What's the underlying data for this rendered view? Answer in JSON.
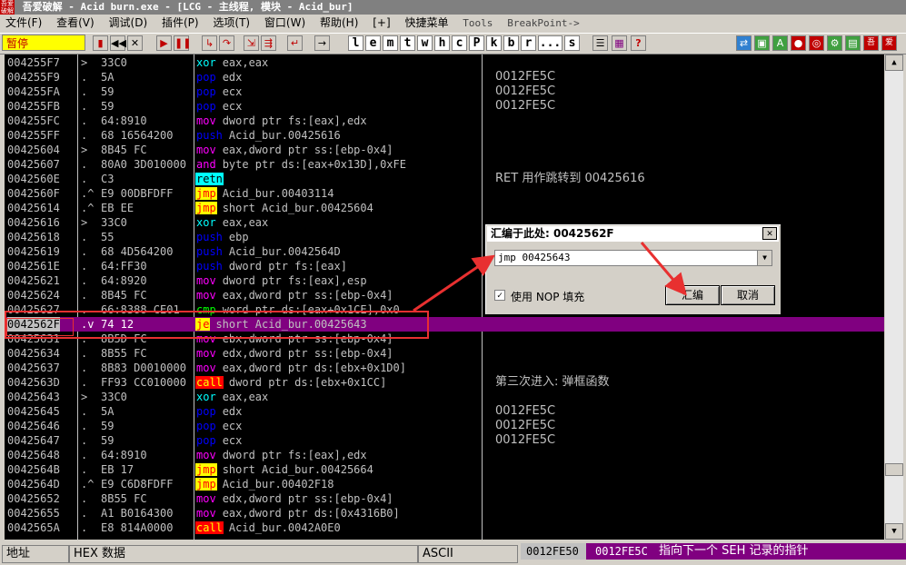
{
  "window": {
    "title": "吾爱破解 - Acid burn.exe - [LCG - 主线程, 模块 - Acid_bur]"
  },
  "menu": [
    "文件(F)",
    "查看(V)",
    "调试(D)",
    "插件(P)",
    "选项(T)",
    "窗口(W)",
    "帮助(H)",
    "[+]",
    "快捷菜单",
    "Tools",
    "BreakPoint->"
  ],
  "toolbar": {
    "status": "暂停",
    "letters": [
      "l",
      "e",
      "m",
      "t",
      "w",
      "h",
      "c",
      "P",
      "k",
      "b",
      "r",
      "...",
      "s"
    ]
  },
  "disasm": {
    "rows": [
      {
        "addr": "004255F7",
        "mark": ">",
        "hex": "33C0",
        "op": "xor",
        "args": "eax,eax",
        "cmt": ""
      },
      {
        "addr": "004255F9",
        "mark": ".",
        "hex": "5A",
        "op": "pop",
        "args": "edx",
        "cmt": "0012FE5C"
      },
      {
        "addr": "004255FA",
        "mark": ".",
        "hex": "59",
        "op": "pop",
        "args": "ecx",
        "cmt": "0012FE5C"
      },
      {
        "addr": "004255FB",
        "mark": ".",
        "hex": "59",
        "op": "pop",
        "args": "ecx",
        "cmt": "0012FE5C"
      },
      {
        "addr": "004255FC",
        "mark": ".",
        "hex": "64:8910",
        "op": "mov",
        "args": "dword ptr fs:[eax],edx",
        "cmt": ""
      },
      {
        "addr": "004255FF",
        "mark": ".",
        "hex": "68 16564200",
        "op": "push",
        "args": "Acid_bur.00425616",
        "cmt": ""
      },
      {
        "addr": "00425604",
        "mark": ">",
        "hex": "8B45 FC",
        "op": "mov",
        "args": "eax,dword ptr ss:[ebp-0x4]",
        "cmt": ""
      },
      {
        "addr": "00425607",
        "mark": ".",
        "hex": "80A0 3D010000",
        "op": "and",
        "args": "byte ptr ds:[eax+0x13D],0xFE",
        "cmt": ""
      },
      {
        "addr": "0042560E",
        "mark": ".",
        "hex": "C3",
        "op": "retn",
        "args": "",
        "cmt": "RET 用作跳转到 00425616"
      },
      {
        "addr": "0042560F",
        "mark": ".^",
        "hex": "E9 00DBFDFF",
        "op": "jmp",
        "args": "Acid_bur.00403114",
        "cmt": ""
      },
      {
        "addr": "00425614",
        "mark": ".^",
        "hex": "EB EE",
        "op": "jmp",
        "args": "short Acid_bur.00425604",
        "cmt": ""
      },
      {
        "addr": "00425616",
        "mark": ">",
        "hex": "33C0",
        "op": "xor",
        "args": "eax,eax",
        "cmt": ""
      },
      {
        "addr": "00425618",
        "mark": ".",
        "hex": "55",
        "op": "push",
        "args": "ebp",
        "cmt": ""
      },
      {
        "addr": "00425619",
        "mark": ".",
        "hex": "68 4D564200",
        "op": "push",
        "args": "Acid_bur.0042564D",
        "cmt": ""
      },
      {
        "addr": "0042561E",
        "mark": ".",
        "hex": "64:FF30",
        "op": "push",
        "args": "dword ptr fs:[eax]",
        "cmt": ""
      },
      {
        "addr": "00425621",
        "mark": ".",
        "hex": "64:8920",
        "op": "mov",
        "args": "dword ptr fs:[eax],esp",
        "cmt": ""
      },
      {
        "addr": "00425624",
        "mark": ".",
        "hex": "8B45 FC",
        "op": "mov",
        "args": "eax,dword ptr ss:[ebp-0x4]",
        "cmt": ""
      },
      {
        "addr": "00425627",
        "mark": ".",
        "hex": "66:8388 CE01",
        "op": "cmp",
        "args": "word ptr ds:[eax+0x1CE],0x0",
        "cmt": ""
      },
      {
        "addr": "0042562F",
        "mark": ".v",
        "hex": "74 12",
        "op": "je",
        "args": "short Acid_bur.00425643",
        "cmt": "",
        "selected": true
      },
      {
        "addr": "00425631",
        "mark": ".",
        "hex": "8B5D FC",
        "op": "mov",
        "args": "ebx,dword ptr ss:[ebp-0x4]",
        "cmt": ""
      },
      {
        "addr": "00425634",
        "mark": ".",
        "hex": "8B55 FC",
        "op": "mov",
        "args": "edx,dword ptr ss:[ebp-0x4]",
        "cmt": ""
      },
      {
        "addr": "00425637",
        "mark": ".",
        "hex": "8B83 D0010000",
        "op": "mov",
        "args": "eax,dword ptr ds:[ebx+0x1D0]",
        "cmt": ""
      },
      {
        "addr": "0042563D",
        "mark": ".",
        "hex": "FF93 CC010000",
        "op": "call",
        "args": "dword ptr ds:[ebx+0x1CC]",
        "cmt": "第三次进入: 弹框函数"
      },
      {
        "addr": "00425643",
        "mark": ">",
        "hex": "33C0",
        "op": "xor",
        "args": "eax,eax",
        "cmt": ""
      },
      {
        "addr": "00425645",
        "mark": ".",
        "hex": "5A",
        "op": "pop",
        "args": "edx",
        "cmt": "0012FE5C"
      },
      {
        "addr": "00425646",
        "mark": ".",
        "hex": "59",
        "op": "pop",
        "args": "ecx",
        "cmt": "0012FE5C"
      },
      {
        "addr": "00425647",
        "mark": ".",
        "hex": "59",
        "op": "pop",
        "args": "ecx",
        "cmt": "0012FE5C"
      },
      {
        "addr": "00425648",
        "mark": ".",
        "hex": "64:8910",
        "op": "mov",
        "args": "dword ptr fs:[eax],edx",
        "cmt": ""
      },
      {
        "addr": "0042564B",
        "mark": ".",
        "hex": "EB 17",
        "op": "jmp",
        "args": "short Acid_bur.00425664",
        "cmt": ""
      },
      {
        "addr": "0042564D",
        "mark": ".^",
        "hex": "E9 C6D8FDFF",
        "op": "jmp",
        "args": "Acid_bur.00402F18",
        "cmt": ""
      },
      {
        "addr": "00425652",
        "mark": ".",
        "hex": "8B55 FC",
        "op": "mov",
        "args": "edx,dword ptr ss:[ebp-0x4]",
        "cmt": ""
      },
      {
        "addr": "00425655",
        "mark": ".",
        "hex": "A1 B0164300",
        "op": "mov",
        "args": "eax,dword ptr ds:[0x4316B0]",
        "cmt": ""
      },
      {
        "addr": "0042565A",
        "mark": ".",
        "hex": "E8 814A0000",
        "op": "call",
        "args": "Acid_bur.0042A0E0",
        "cmt": ""
      }
    ]
  },
  "bottom": {
    "addr_label": "地址",
    "hex_label": "HEX 数据",
    "ascii_label": "ASCII",
    "stack_addr": "0012FE50",
    "stack_val": "0012FE5C",
    "stack_comment": "指向下一个 SEH 记录的指针"
  },
  "dialog": {
    "title": "汇编于此处: 0042562F",
    "input_value": "jmp 00425643",
    "nop_label": "使用 NOP 填充",
    "nop_checked": "✓",
    "assemble_button": "汇编",
    "cancel_button": "取消",
    "close_glyph": "✕"
  },
  "colors": {
    "highlight_row": "#800080",
    "annotation": "#e83030"
  }
}
